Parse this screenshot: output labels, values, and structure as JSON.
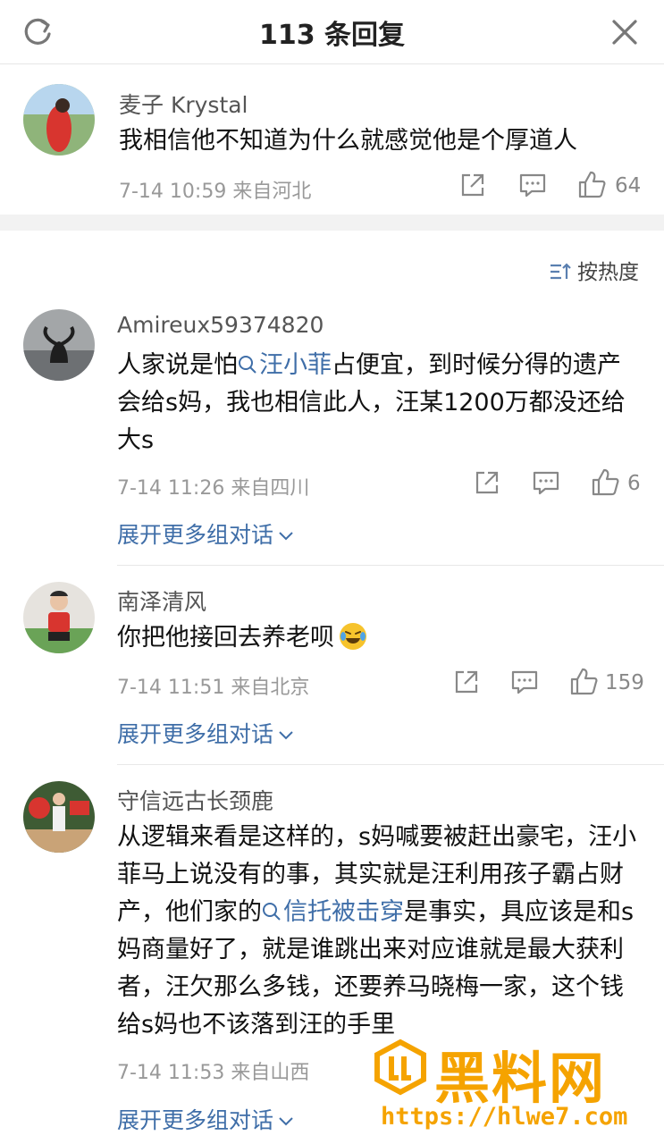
{
  "header": {
    "title": "113 条回复",
    "refresh_icon": "refresh-icon",
    "close_icon": "close-icon"
  },
  "top_comment": {
    "name": "麦子 Krystal",
    "text": "我相信他不知道为什么就感觉他是个厚道人",
    "meta": "7-14 10:59  来自河北",
    "likes": "64"
  },
  "sort_label": "按热度",
  "comments": [
    {
      "name": "Amireux59374820",
      "text_before": "人家说是怕",
      "tag": "汪小菲",
      "text_after": "占便宜，到时候分得的遗产会给s妈，我也相信此人，汪某1200万都没还给大s",
      "meta": "7-14 11:26  来自四川",
      "likes": "6",
      "expand": "展开更多组对话"
    },
    {
      "name": "南泽清风",
      "text": "你把他接回去养老呗",
      "meta": "7-14 11:51  来自北京",
      "likes": "159",
      "expand": "展开更多组对话"
    },
    {
      "name": "守信远古长颈鹿",
      "text_before": "从逻辑来看是这样的，s妈喊要被赶出豪宅，汪小菲马上说没有的事，其实就是汪利用孩子霸占财产，他们家的",
      "tag": "信托被击穿",
      "text_after": "是事实，具应该是和s妈商量好了，就是谁跳出来对应谁就是最大获利者，汪欠那么多钱，还要养马晓梅一家，这个钱给s妈也不该落到汪的手里",
      "meta": "7-14 11:53  来自山西",
      "expand": "展开更多组对话"
    }
  ],
  "watermark": {
    "brand": "黑料网",
    "url": "https://hlwe7.com"
  },
  "colors": {
    "link": "#3f6ea8",
    "meta": "#999999",
    "watermark": "#f5a300",
    "gap": "#f2f2f2"
  }
}
